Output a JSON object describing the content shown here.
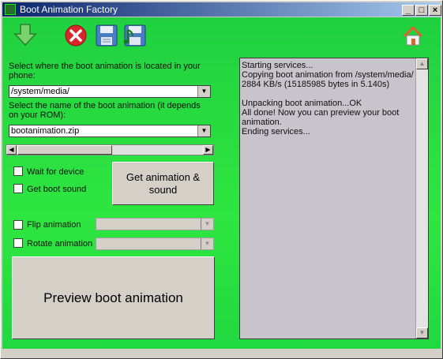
{
  "window": {
    "title": "Boot Animation Factory",
    "minimize_glyph": "_",
    "maximize_glyph": "□",
    "close_glyph": "×"
  },
  "toolbar": {
    "icons": [
      "download-arrow-icon",
      "cancel-icon",
      "save-icon",
      "save-sound-icon",
      "home-icon"
    ]
  },
  "location": {
    "label": "Select where the boot animation is located in your phone:",
    "value": "/system/media/"
  },
  "filename": {
    "label": "Select the name of the boot animation (it depends on your ROM):",
    "value": "bootanimation.zip"
  },
  "options": {
    "wait_for_device": "Wait for device",
    "get_boot_sound": "Get boot sound",
    "get_animation_button": "Get animation & sound",
    "flip_animation": "Flip animation",
    "rotate_animation": "Rotate animation"
  },
  "preview_button": "Preview boot animation",
  "log": {
    "text": "Starting services...\nCopying boot animation from /system/media/\n2884 KB/s (15185985 bytes in 5.140s)\n\nUnpacking boot animation...OK\nAll done! Now you can preview your boot animation.\nEnding services..."
  },
  "colors": {
    "background_green": "#2fe640",
    "titlebar": "#0a246a"
  }
}
